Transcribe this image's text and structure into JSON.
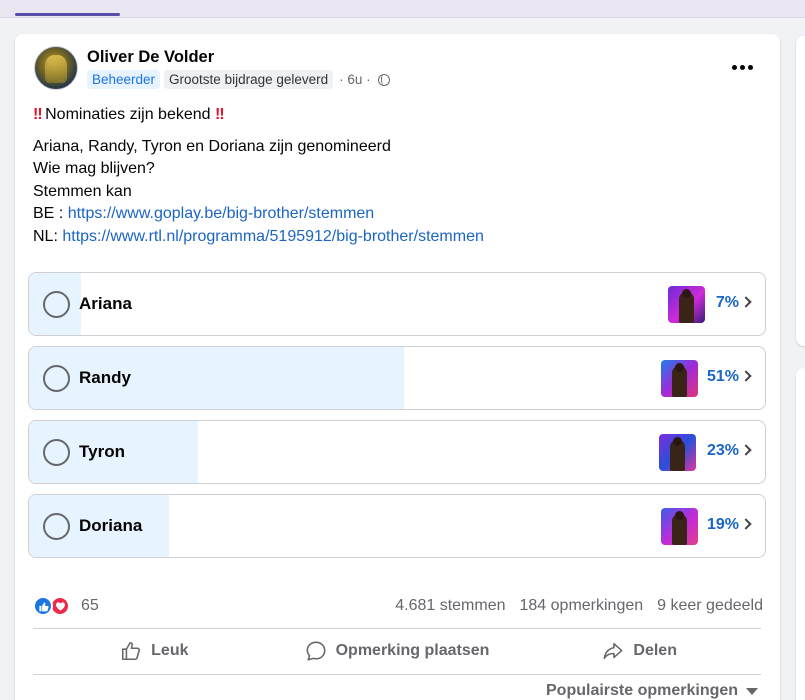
{
  "post": {
    "author": "Oliver De Volder",
    "badges": [
      "Beheerder",
      "Grootste bijdrage geleverd"
    ],
    "time": "· 6u ·",
    "title_excl_left": "‼",
    "title": "Nominaties zijn bekend",
    "title_excl_right": "‼",
    "lines": [
      "Ariana, Randy,  Tyron en Doriana zijn genomineerd",
      "Wie mag blijven?",
      "Stemmen kan"
    ],
    "link_be_prefix": "BE : ",
    "link_be": "https://www.goplay.be/big-brother/stemmen",
    "link_nl_prefix": "NL: ",
    "link_nl": "https://www.rtl.nl/programma/5195912/big-brother/stemmen"
  },
  "poll": {
    "options": [
      {
        "label": "Ariana",
        "percent_label": "7%",
        "percent": 7
      },
      {
        "label": "Randy",
        "percent_label": "51%",
        "percent": 51
      },
      {
        "label": "Tyron",
        "percent_label": "23%",
        "percent": 23
      },
      {
        "label": "Doriana",
        "percent_label": "19%",
        "percent": 19
      }
    ]
  },
  "stats": {
    "reactions_count": "65",
    "votes": "4.681 stemmen",
    "comments": "184 opmerkingen",
    "shares": "9 keer gedeeld"
  },
  "actions": {
    "like": "Leuk",
    "comment": "Opmerking plaatsen",
    "share": "Delen"
  },
  "comments_sort": "Populairste opmerkingen",
  "colors": {
    "link": "#1b65c6",
    "poll_fill": "#e7f3ff",
    "like": "#1b74e4",
    "love": "#f02849"
  }
}
